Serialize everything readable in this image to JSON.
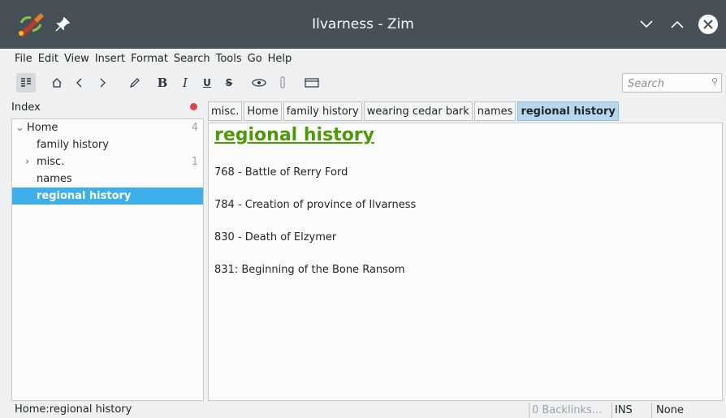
{
  "window": {
    "title": "Ilvarness - Zim",
    "colors": {
      "titlebar": "#475057",
      "accent": "#3daee9",
      "heading": "#4e9a06"
    }
  },
  "menu": [
    "File",
    "Edit",
    "View",
    "Insert",
    "Format",
    "Search",
    "Tools",
    "Go",
    "Help"
  ],
  "toolbar": {
    "bold": "B",
    "italic": "I",
    "underline": "U",
    "strike": "S"
  },
  "search": {
    "placeholder": "Search"
  },
  "index": {
    "title": "Index",
    "items": [
      {
        "label": "Home",
        "count": "4",
        "expander": "⌄"
      },
      {
        "label": "family history"
      },
      {
        "label": "misc.",
        "count": "1",
        "expander": "›"
      },
      {
        "label": "names"
      },
      {
        "label": "regional history"
      }
    ]
  },
  "pathbar": [
    "misc.",
    "Home",
    "family history",
    "wearing cedar bark",
    "names",
    "regional history"
  ],
  "page": {
    "title": "regional history",
    "lines": [
      "768 - Battle of Rerry Ford",
      "784 - Creation of province of Ilvarness",
      "830 - Death of Elzymer",
      "831: Beginning of the Bone Ransom"
    ]
  },
  "status": {
    "path": "Home:regional history",
    "backlinks": "0 Backlinks...",
    "mode": "INS",
    "style": "None"
  }
}
